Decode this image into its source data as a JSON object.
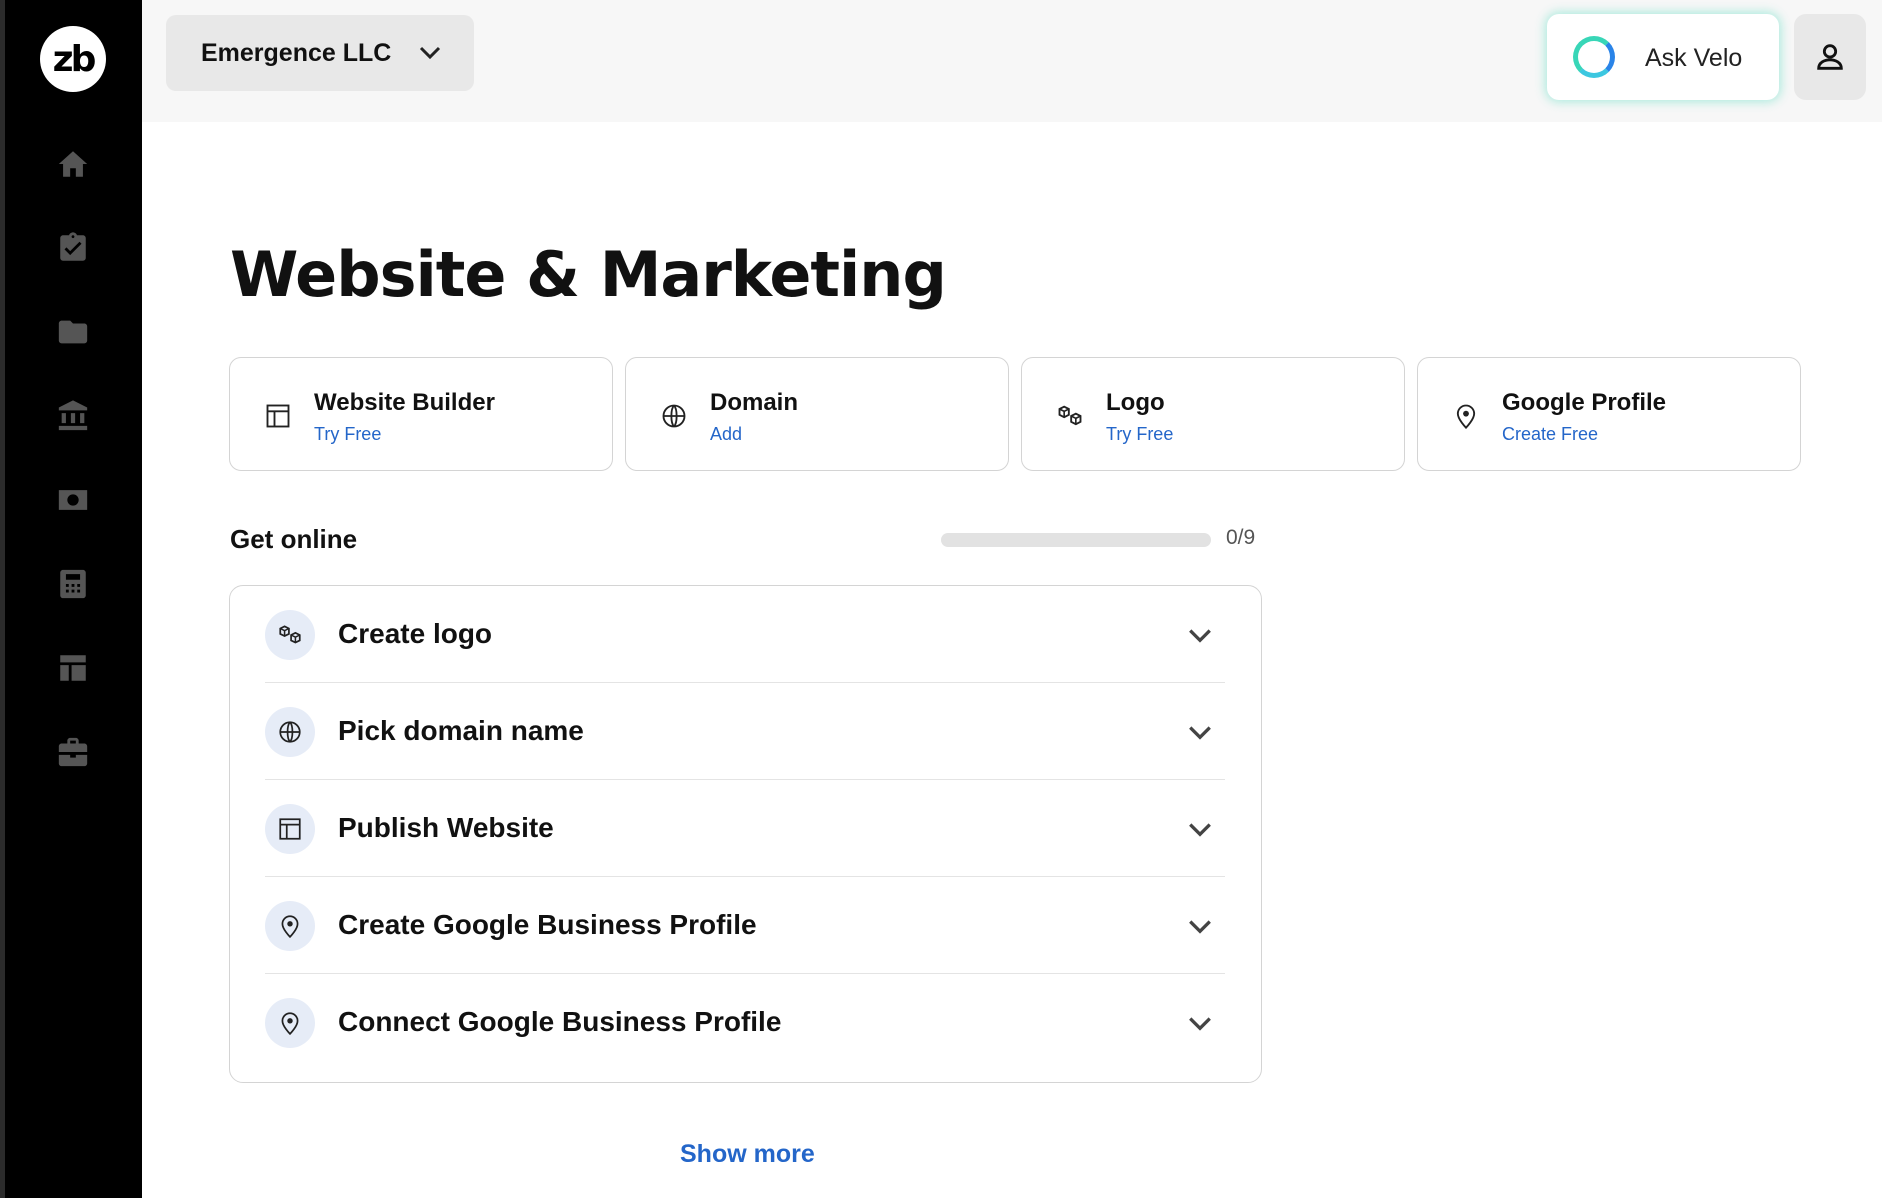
{
  "sidebar": {
    "logo_text": "zb",
    "items": [
      {
        "icon": "home-icon"
      },
      {
        "icon": "clipboard-check-icon"
      },
      {
        "icon": "folder-icon"
      },
      {
        "icon": "bank-icon"
      },
      {
        "icon": "cash-icon"
      },
      {
        "icon": "calculator-icon"
      },
      {
        "icon": "layout-icon"
      },
      {
        "icon": "briefcase-icon"
      }
    ]
  },
  "header": {
    "company_name": "Emergence LLC",
    "ask_velo_label": "Ask Velo"
  },
  "page": {
    "title": "Website & Marketing"
  },
  "cards": [
    {
      "title": "Website Builder",
      "subtitle": "Try Free",
      "icon": "layout-icon"
    },
    {
      "title": "Domain",
      "subtitle": "Add",
      "icon": "globe-icon"
    },
    {
      "title": "Logo",
      "subtitle": "Try Free",
      "icon": "cubes-icon"
    },
    {
      "title": "Google Profile",
      "subtitle": "Create Free",
      "icon": "map-pin-icon"
    }
  ],
  "get_online": {
    "label": "Get online",
    "progress_text": "0/9",
    "progress_fraction": 0
  },
  "tasks": [
    {
      "label": "Create logo",
      "icon": "cubes-icon"
    },
    {
      "label": "Pick domain name",
      "icon": "globe-icon"
    },
    {
      "label": "Publish Website",
      "icon": "layout-icon"
    },
    {
      "label": "Create Google Business Profile",
      "icon": "map-pin-icon"
    },
    {
      "label": "Connect Google Business Profile",
      "icon": "map-pin-icon"
    }
  ],
  "show_more_label": "Show more",
  "colors": {
    "accent_blue": "#2466c9",
    "sidebar_bg": "#000000",
    "velo_glow": "#38d6b7"
  }
}
